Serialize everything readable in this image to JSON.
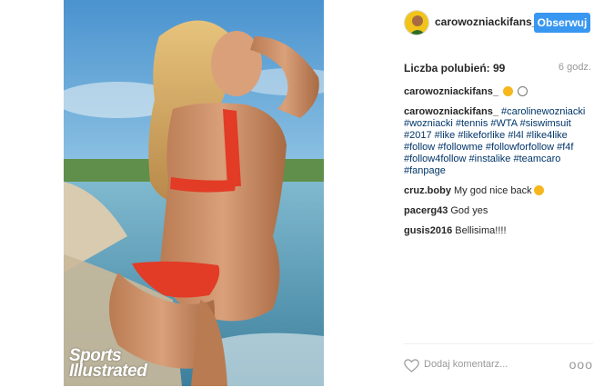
{
  "post": {
    "image_alt": "Sports Illustrated swimsuit photo",
    "brand_line1": "Sports",
    "brand_line2": "Illustrated"
  },
  "header": {
    "username": "carowozniackifans_",
    "follow_label": "Obserwuj",
    "avatar_icon": "avatar-icon"
  },
  "stats": {
    "likes_label": "Liczba polubień: 99",
    "time": "6 godz."
  },
  "caption": {
    "user": "carowozniackifans_",
    "line2_user": "carowozniackifans_",
    "hashtags": "#carolinewozniacki #wozniacki #tennis #WTA #siswimsuit #2017 #like #likeforlike #l4l #like4like #follow #followme #followforfollow #f4f #follow4follow #instalike #teamcaro #fanpage"
  },
  "comments": [
    {
      "user": "cruz.boby",
      "text": "My god nice back"
    },
    {
      "user": "pacerg43",
      "text": "God yes"
    },
    {
      "user": "gusis2016",
      "text": "Bellisima!!!!"
    }
  ],
  "footer": {
    "comment_placeholder": "Dodaj komentarz...",
    "more_label": "ooo"
  },
  "colors": {
    "accent": "#3897f0",
    "hashtag": "#003569",
    "muted": "#999999"
  }
}
